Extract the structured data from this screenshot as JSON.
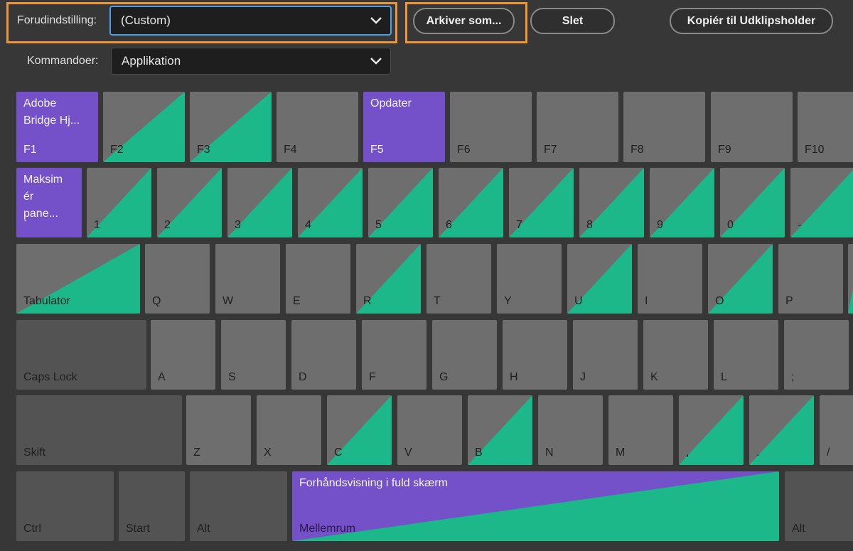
{
  "toolbar": {
    "preset_label": "Forudindstilling:",
    "preset_value": "(Custom)",
    "save_as_label": "Arkiver som...",
    "delete_label": "Slet",
    "copy_label": "Kopiér til Udklipsholder",
    "commands_label": "Kommandoer:",
    "commands_value": "Applikation"
  },
  "colors": {
    "background": "#373737",
    "key": "#6e6e6e",
    "modifier_key": "#535353",
    "app_shortcut": "#7450c9",
    "panel_shortcut": "#1db88a",
    "highlight": "#f0963a",
    "focus": "#4f9ee8"
  },
  "keyboard": {
    "function_row": [
      {
        "label": "F1",
        "command": "Adobe\nBridge Hj..."
      },
      {
        "label": "F2"
      },
      {
        "label": "F3"
      },
      {
        "label": "F4"
      },
      {
        "label": "F5",
        "command": "Opdater"
      },
      {
        "label": "F6"
      },
      {
        "label": "F7"
      },
      {
        "label": "F8"
      },
      {
        "label": "F9"
      },
      {
        "label": "F10"
      }
    ],
    "number_row": [
      {
        "label": "`",
        "command": "Maksim\nér\npane..."
      },
      {
        "label": "1"
      },
      {
        "label": "2"
      },
      {
        "label": "3"
      },
      {
        "label": "4"
      },
      {
        "label": "5"
      },
      {
        "label": "6"
      },
      {
        "label": "7"
      },
      {
        "label": "8"
      },
      {
        "label": "9"
      },
      {
        "label": "0"
      },
      {
        "label": "-"
      }
    ],
    "q_row": [
      {
        "label": "Tabulator"
      },
      {
        "label": "Q"
      },
      {
        "label": "W"
      },
      {
        "label": "E"
      },
      {
        "label": "R"
      },
      {
        "label": "T"
      },
      {
        "label": "Y"
      },
      {
        "label": "U"
      },
      {
        "label": "I"
      },
      {
        "label": "O"
      },
      {
        "label": "P"
      },
      {
        "label": ""
      }
    ],
    "a_row": [
      {
        "label": "Caps Lock"
      },
      {
        "label": "A"
      },
      {
        "label": "S"
      },
      {
        "label": "D"
      },
      {
        "label": "F"
      },
      {
        "label": "G"
      },
      {
        "label": "H"
      },
      {
        "label": "J"
      },
      {
        "label": "K"
      },
      {
        "label": "L"
      },
      {
        "label": ";"
      }
    ],
    "z_row": [
      {
        "label": "Skift"
      },
      {
        "label": "Z"
      },
      {
        "label": "X"
      },
      {
        "label": "C"
      },
      {
        "label": "V"
      },
      {
        "label": "B"
      },
      {
        "label": "N"
      },
      {
        "label": "M"
      },
      {
        "label": ","
      },
      {
        "label": "."
      },
      {
        "label": "/"
      }
    ],
    "bottom_row": [
      {
        "label": "Ctrl"
      },
      {
        "label": "Start"
      },
      {
        "label": "Alt"
      },
      {
        "label": "Mellemrum",
        "command": "Forhåndsvisning i fuld skærm"
      },
      {
        "label": "Alt"
      }
    ]
  }
}
